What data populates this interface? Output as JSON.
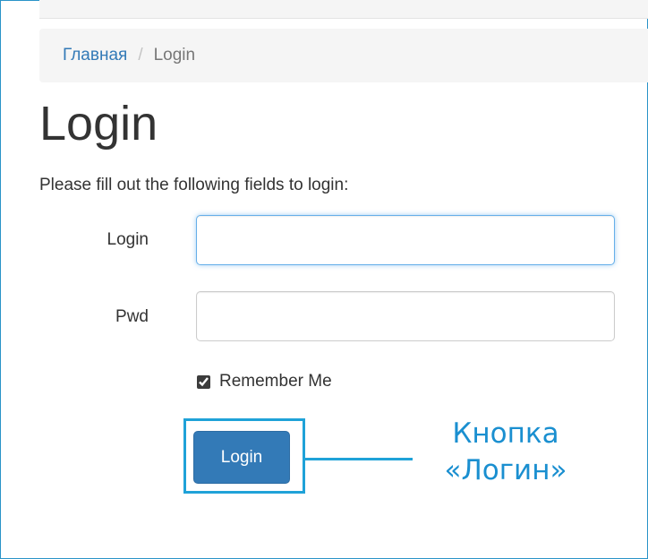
{
  "breadcrumb": {
    "home": "Главная",
    "separator": "/",
    "current": "Login"
  },
  "page": {
    "title": "Login",
    "intro": "Please fill out the following fields to login:"
  },
  "form": {
    "login_label": "Login",
    "login_value": "",
    "pwd_label": "Pwd",
    "pwd_value": "",
    "remember_label": "Remember Me",
    "remember_checked": true,
    "submit_label": "Login"
  },
  "annotation": {
    "line1": "Кнопка",
    "line2": "«Логин»",
    "color": "#1fa2d8"
  },
  "colors": {
    "primary": "#337ab7",
    "link": "#337ab7",
    "focus": "#66afe9",
    "frame": "#2a93c8"
  }
}
